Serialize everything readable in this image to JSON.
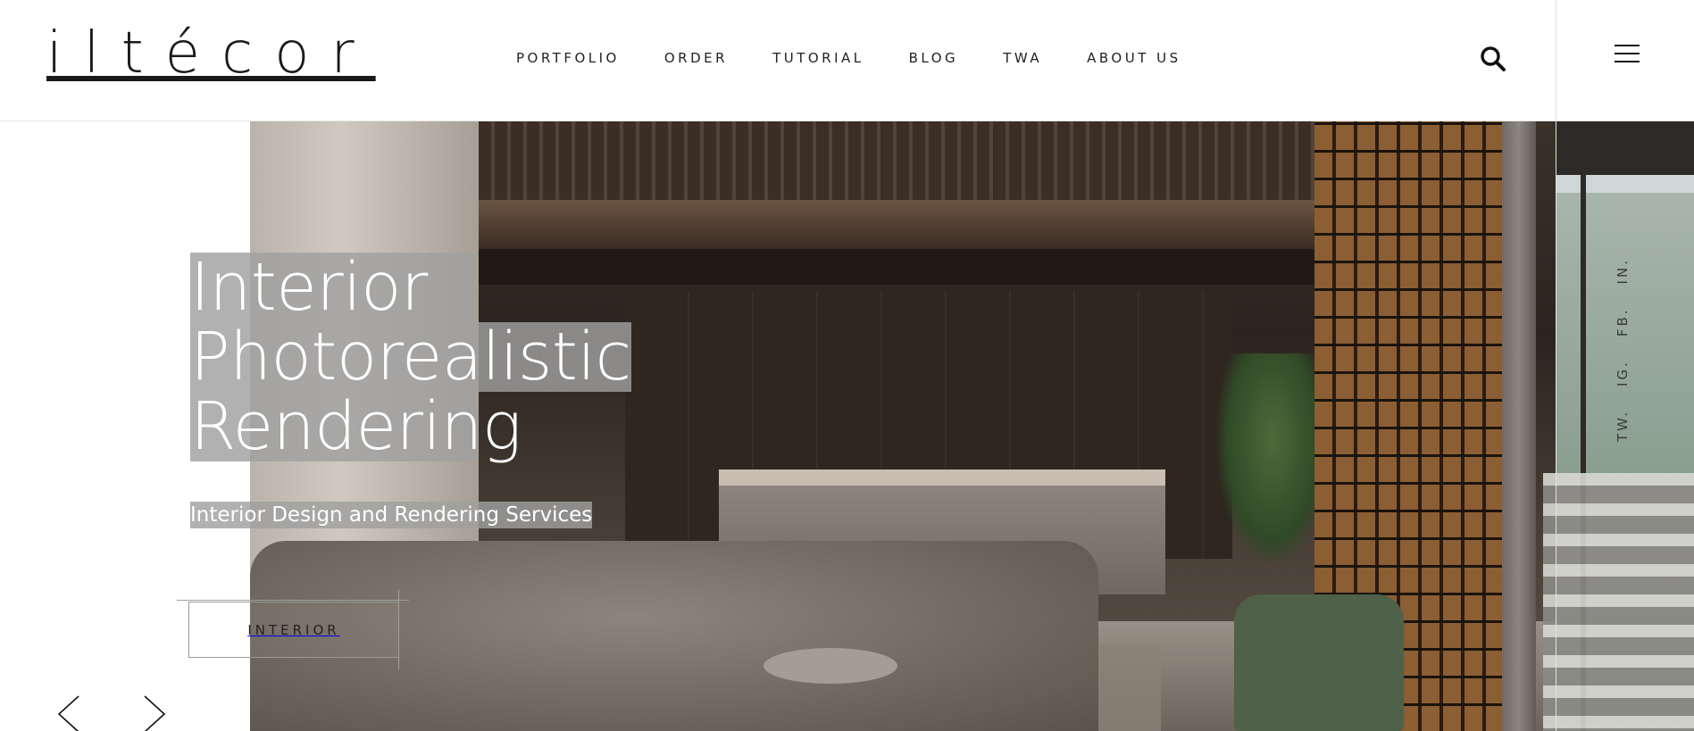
{
  "brand": {
    "logo_text": "iltécor"
  },
  "nav": {
    "items": [
      "PORTFOLIO",
      "ORDER",
      "TUTORIAL",
      "BLOG",
      "TWA",
      "ABOUT US"
    ]
  },
  "header": {
    "search_icon": "search-icon",
    "menu_icon": "hamburger-menu-icon"
  },
  "hero": {
    "title_lines": [
      "Interior",
      "Photorealistic",
      "Rendering"
    ],
    "subtitle": "Interior Design and Rendering Services",
    "cta_label": "INTERIOR",
    "image_alt": "interior-rendering-photo",
    "prev_icon": "chevron-left-icon",
    "next_icon": "chevron-right-icon"
  },
  "social": {
    "items": [
      "TW.",
      "IG.",
      "FB.",
      "IN."
    ]
  },
  "colors": {
    "text": "#111111",
    "highlight_bg": "#a0a0a0",
    "border": "#e2e2e2"
  }
}
